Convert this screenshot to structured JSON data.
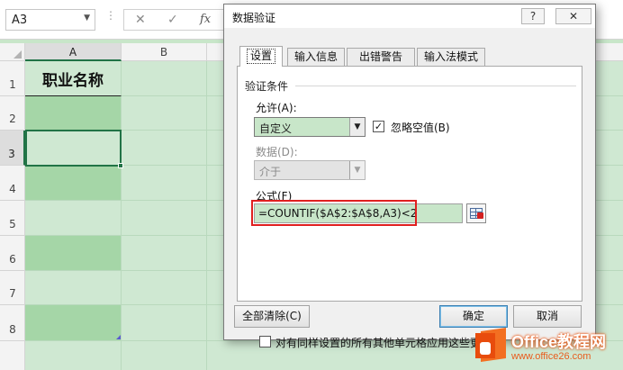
{
  "formula_bar": {
    "name_box": "A3",
    "name_box_arrow": "▼",
    "dots": "⋮",
    "cancel_glyph": "✕",
    "enter_glyph": "✓",
    "fx": "fx"
  },
  "sheet": {
    "columns": [
      "A",
      "B"
    ],
    "rows": [
      "1",
      "2",
      "3",
      "4",
      "5",
      "6",
      "7",
      "8"
    ],
    "header_cell": "职业名称",
    "active_row": "3"
  },
  "dialog": {
    "title": "数据验证",
    "help_glyph": "?",
    "close_glyph": "✕",
    "tabs": [
      "设置",
      "输入信息",
      "出错警告",
      "输入法模式"
    ],
    "section_label": "验证条件",
    "allow_label": "允许(A):",
    "allow_value": "自定义",
    "ignore_blank_checked": "✓",
    "ignore_blank_label": "忽略空值(B)",
    "data_label": "数据(D):",
    "data_value": "介于",
    "formula_label": "公式(F)",
    "formula_value": "=COUNTIF($A$2:$A$8,A3)<2",
    "apply_all_label": "对有同样设置的所有其他单元格应用这些更改(P)",
    "clear_all": "全部清除(C)",
    "ok": "确定",
    "cancel": "取消",
    "dropdown_glyph": "▼"
  },
  "watermark": {
    "title": "Office教程网",
    "site": "www.office26.com"
  },
  "colors": {
    "excel_green": "#217346",
    "cell_green_dark": "#a5d6a7",
    "cell_green_light": "#cfe8d2",
    "highlight_red": "#e02020",
    "watermark_orange": "#e85b1c"
  }
}
